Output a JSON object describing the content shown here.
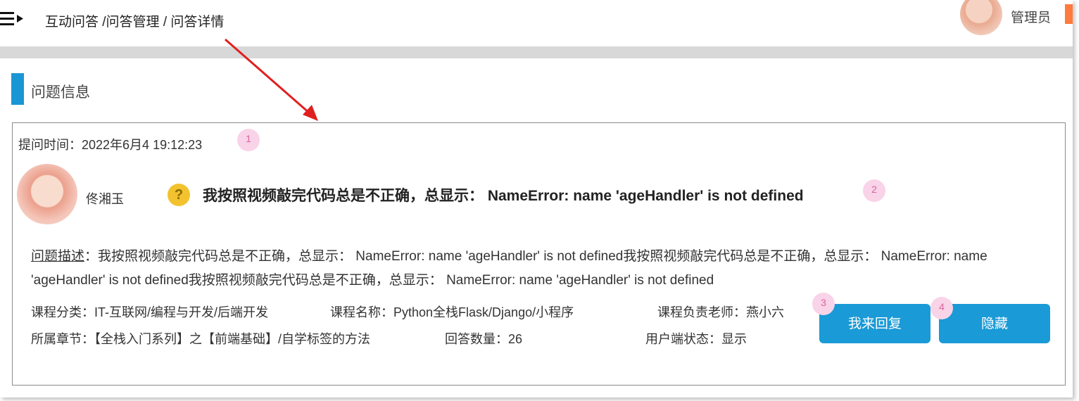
{
  "header": {
    "breadcrumb": "互动问答 /问答管理 / 问答详情",
    "user_label": "管理员"
  },
  "section": {
    "title": "问题信息"
  },
  "question": {
    "time_label": "提问时间：",
    "time_value": "2022年6月4 19:12:23",
    "username": "佟湘玉",
    "title": "我按照视频敲完代码总是不正确，总显示： NameError: name 'ageHandler' is not defined",
    "description_label": "问题描述",
    "description_text": "：我按照视频敲完代码总是不正确，总显示： NameError: name 'ageHandler' is not defined我按照视频敲完代码总是不正确，总显示： NameError: name 'ageHandler' is not defined我按照视频敲完代码总是不正确，总显示： NameError: name 'ageHandler' is not defined"
  },
  "info": {
    "category": "课程分类：IT-互联网/编程与开发/后端开发",
    "course_name": "课程名称：Python全栈Flask/Django/小程序",
    "teacher": "课程负责老师：燕小六",
    "chapter": "所属章节：【全栈入门系列】之【前端基础】/自学标签的方法",
    "answer_count": "回答数量：26",
    "status": "用户端状态：显示"
  },
  "buttons": {
    "reply": "我来回复",
    "hide": "隐藏"
  },
  "markers": [
    "1",
    "2",
    "3",
    "4"
  ],
  "icons": {
    "menu": "menu-icon",
    "question": "question-icon",
    "arrow": "red-arrow"
  },
  "colors": {
    "accent": "#1a96d4",
    "button": "#1a9ad6",
    "marker": "#f9d3e8",
    "question": "#f2c22f",
    "arrow": "#e02020",
    "badge": "#ff7a3d"
  }
}
